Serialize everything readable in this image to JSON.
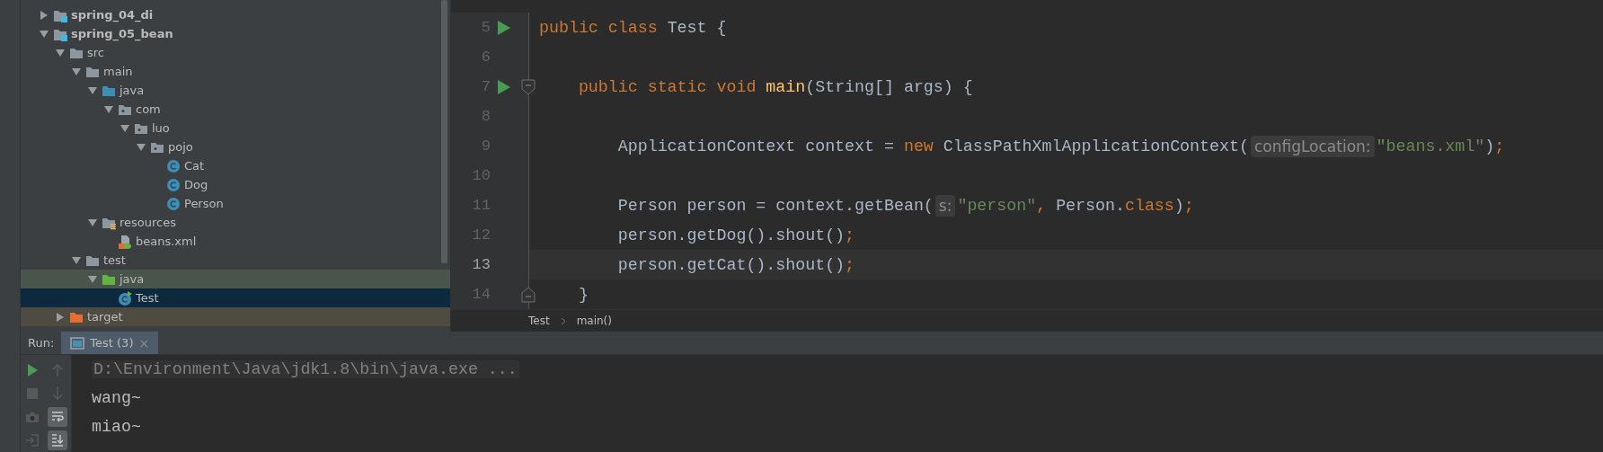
{
  "project_tree": [
    {
      "label": "spring_04_di",
      "kind": "module",
      "expanded": false,
      "selected": false
    },
    {
      "label": "spring_05_bean",
      "kind": "module",
      "expanded": true,
      "selected": false,
      "children": [
        {
          "label": "src",
          "kind": "folder",
          "expanded": true,
          "selected": false,
          "children": [
            {
              "label": "main",
              "kind": "folder",
              "expanded": true,
              "selected": false,
              "children": [
                {
                  "label": "java",
                  "kind": "source_folder",
                  "expanded": true,
                  "selected": false,
                  "children": [
                    {
                      "label": "com",
                      "kind": "package",
                      "expanded": true,
                      "selected": false,
                      "children": [
                        {
                          "label": "luo",
                          "kind": "package",
                          "expanded": true,
                          "selected": false,
                          "children": [
                            {
                              "label": "pojo",
                              "kind": "package",
                              "expanded": true,
                              "selected": false,
                              "children": [
                                {
                                  "label": "Cat",
                                  "kind": "class",
                                  "selected": false
                                },
                                {
                                  "label": "Dog",
                                  "kind": "class",
                                  "selected": false
                                },
                                {
                                  "label": "Person",
                                  "kind": "class",
                                  "selected": false
                                }
                              ]
                            }
                          ]
                        }
                      ]
                    }
                  ]
                },
                {
                  "label": "resources",
                  "kind": "resources_folder",
                  "expanded": true,
                  "selected": false,
                  "children": [
                    {
                      "label": "beans.xml",
                      "kind": "xml_file",
                      "selected": false
                    }
                  ]
                }
              ]
            },
            {
              "label": "test",
              "kind": "folder",
              "expanded": true,
              "selected": false,
              "children": [
                {
                  "label": "java",
                  "kind": "test_folder",
                  "expanded": true,
                  "selected": false,
                  "children": [
                    {
                      "label": "Test",
                      "kind": "test_class",
                      "selected": true
                    }
                  ]
                }
              ]
            }
          ]
        },
        {
          "label": "target",
          "kind": "excluded_folder",
          "expanded": false,
          "selected": false
        }
      ]
    }
  ],
  "editor": {
    "lines": [
      {
        "number": "5",
        "run": true,
        "current": false,
        "tokens": [
          {
            "kind": "keyword",
            "text": "public class "
          },
          {
            "kind": "plain",
            "text": "Test {"
          }
        ]
      },
      {
        "number": "6",
        "run": false,
        "current": false
      },
      {
        "number": "7",
        "run": true,
        "fold_start": true,
        "current": false,
        "tokens": [
          {
            "kind": "keyword",
            "text": "    public static void "
          },
          {
            "kind": "method",
            "text": "main"
          },
          {
            "kind": "plain",
            "text": "(String[] args) {"
          }
        ]
      },
      {
        "number": "8",
        "run": false,
        "current": false
      },
      {
        "number": "9",
        "run": false,
        "current": false,
        "tokens": [
          {
            "kind": "plain",
            "text": "        ApplicationContext context = "
          },
          {
            "kind": "keyword",
            "text": "new "
          },
          {
            "kind": "plain",
            "text": "ClassPathXmlApplicationContext("
          },
          {
            "kind": "hint",
            "text": "configLocation:"
          },
          {
            "kind": "string",
            "text": "\"beans.xml\""
          },
          {
            "kind": "plain",
            "text": ")"
          },
          {
            "kind": "keyword",
            "text": ";"
          }
        ]
      },
      {
        "number": "10",
        "run": false,
        "current": false
      },
      {
        "number": "11",
        "run": false,
        "current": false,
        "tokens": [
          {
            "kind": "plain",
            "text": "        Person person = context.getBean("
          },
          {
            "kind": "hint",
            "text": "s:"
          },
          {
            "kind": "string",
            "text": "\"person\""
          },
          {
            "kind": "keyword",
            "text": ", "
          },
          {
            "kind": "plain",
            "text": "Person."
          },
          {
            "kind": "keyword",
            "text": "class"
          },
          {
            "kind": "plain",
            "text": ")"
          },
          {
            "kind": "keyword",
            "text": ";"
          }
        ]
      },
      {
        "number": "12",
        "run": false,
        "current": false,
        "tokens": [
          {
            "kind": "plain",
            "text": "        person.getDog().shout()"
          },
          {
            "kind": "keyword",
            "text": ";"
          }
        ]
      },
      {
        "number": "13",
        "run": false,
        "current": true,
        "tokens": [
          {
            "kind": "plain",
            "text": "        person.getCat().shout()"
          },
          {
            "kind": "keyword",
            "text": ";"
          }
        ]
      },
      {
        "number": "14",
        "run": false,
        "fold_end": true,
        "current": false,
        "tokens": [
          {
            "kind": "plain",
            "text": "    }"
          }
        ]
      }
    ],
    "breadcrumbs": [
      "Test",
      "main()"
    ]
  },
  "run_panel": {
    "label": "Run:",
    "tab": {
      "title": "Test (3)",
      "close": "×"
    },
    "toolbar": [
      {
        "kind": "rerun",
        "disabled": false,
        "on": false
      },
      {
        "kind": "up",
        "disabled": true,
        "on": false
      },
      {
        "kind": "stop",
        "disabled": true,
        "on": false
      },
      {
        "kind": "down",
        "disabled": true,
        "on": false
      },
      {
        "kind": "camera",
        "disabled": true,
        "on": false
      },
      {
        "kind": "wrap",
        "disabled": false,
        "on": true
      },
      {
        "kind": "exit",
        "disabled": true,
        "on": false
      },
      {
        "kind": "scroll_end",
        "disabled": false,
        "on": true
      }
    ],
    "console": [
      {
        "text": "D:\\Environment\\Java\\jdk1.8\\bin\\java.exe ...",
        "kind": "command"
      },
      {
        "text": "wang~",
        "kind": "output"
      },
      {
        "text": "miao~",
        "kind": "output"
      }
    ]
  }
}
